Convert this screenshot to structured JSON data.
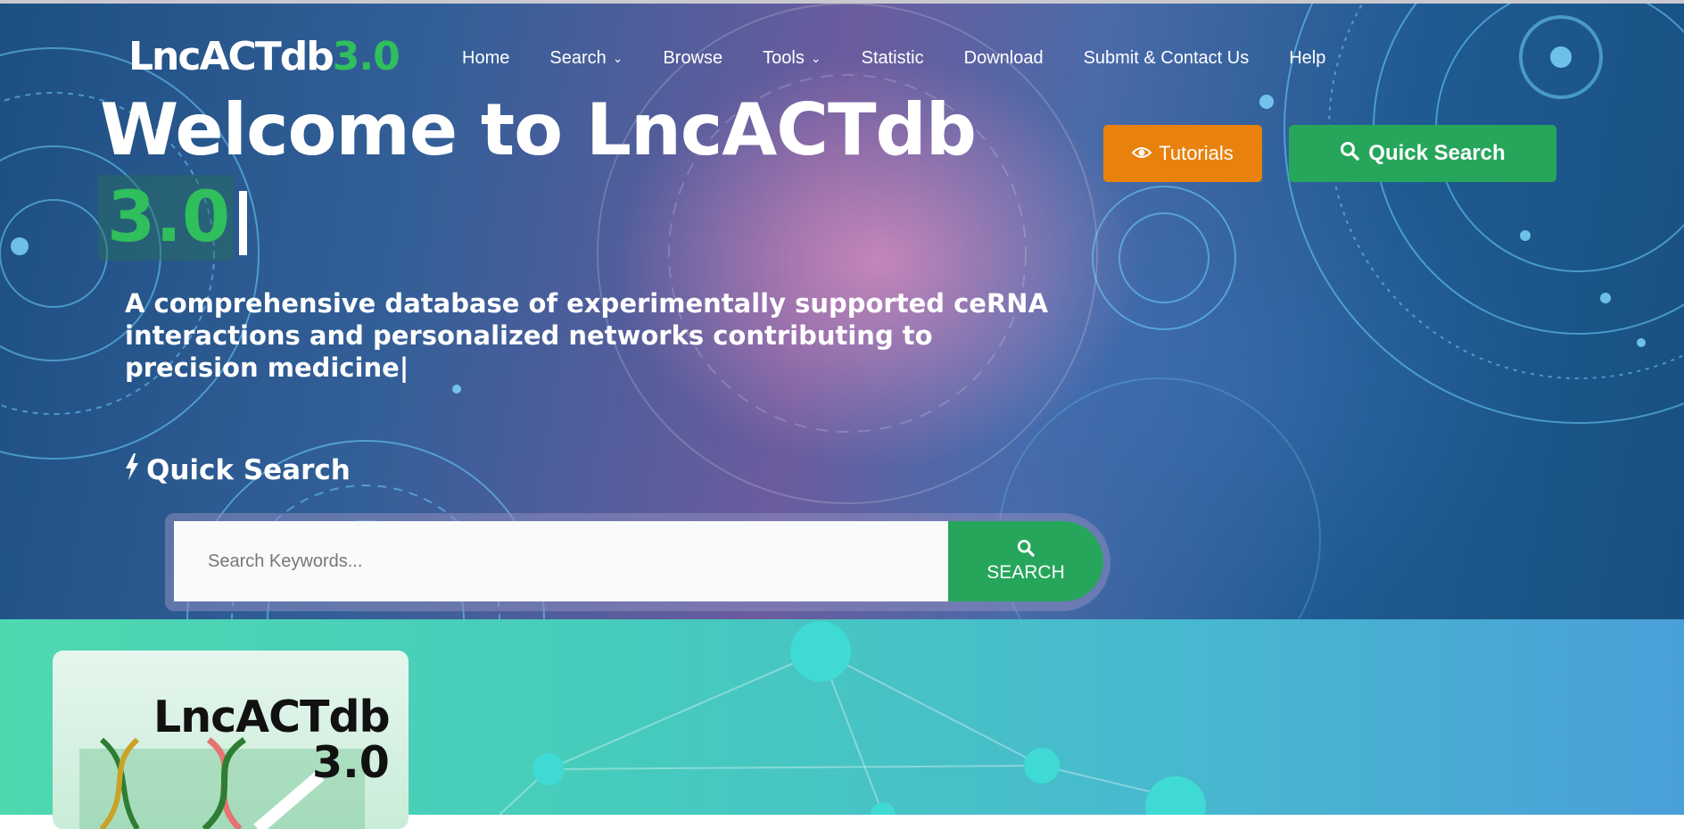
{
  "logo": {
    "name": "LncACTdb",
    "version": "3.0"
  },
  "nav": {
    "home": "Home",
    "search": "Search",
    "browse": "Browse",
    "tools": "Tools",
    "statistic": "Statistic",
    "download": "Download",
    "submit": "Submit & Contact Us",
    "help": "Help"
  },
  "hero": {
    "title": "Welcome to LncACTdb",
    "version": "3.0",
    "subtitle": "A comprehensive database of experimentally supported ceRNA interactions and personalized networks contributing to precision medicine|",
    "tutorials_label": "Tutorials",
    "quick_search_label": "Quick Search"
  },
  "quick_search": {
    "heading": "Quick Search",
    "placeholder": "Search Keywords...",
    "button_label": "SEARCH"
  },
  "card": {
    "title": "LncACTdb",
    "version": "3.0"
  },
  "icons": {
    "nav_dropdown": "chevron-down-icon",
    "tutorials": "eye-icon",
    "quick_search": "search-icon",
    "heading": "bolt-icon"
  },
  "colors": {
    "brand_green": "#26a65b",
    "tutorial_orange": "#e8820d",
    "logo_version_green": "#2fbf5c"
  }
}
